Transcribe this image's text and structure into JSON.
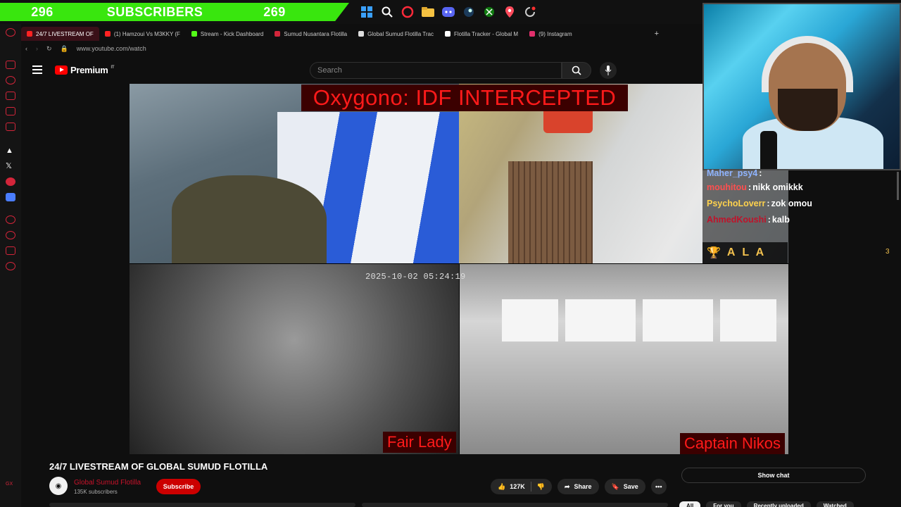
{
  "overlay": {
    "subs_left": "296",
    "subs_label": "SUBSCRIBERS",
    "subs_right": "269"
  },
  "taskbar": {
    "icons": [
      "windows-icon",
      "search-icon",
      "opera-icon",
      "folder-icon",
      "discord-icon",
      "steam-icon",
      "xbox-icon",
      "maps-icon",
      "spinner-icon"
    ]
  },
  "browser": {
    "tabs": [
      {
        "label": "24/7 LIVESTREAM OF",
        "color": "#ff2222",
        "active": true
      },
      {
        "label": "(1) Hamzoui Vs M3KKY (F",
        "color": "#ff2222",
        "active": false
      },
      {
        "label": "Stream - Kick Dashboard",
        "color": "#53fc18",
        "active": false
      },
      {
        "label": "Sumud Nusantara Flotilla",
        "color": "#d3253a",
        "active": false
      },
      {
        "label": "Global Sumud Flotilla Trac",
        "color": "#dddddd",
        "active": false
      },
      {
        "label": "Flotilla Tracker - Global M",
        "color": "#ffffff",
        "active": false
      },
      {
        "label": "(9) Instagram",
        "color": "#e1306c",
        "active": false
      }
    ],
    "new_tab": "+",
    "url": "www.youtube.com/watch"
  },
  "youtube": {
    "logo": "Premium",
    "region": "IT",
    "search_placeholder": "Search"
  },
  "video": {
    "banner": "Oxygono: IDF INTERCEPTED",
    "timestamp": "2025-10-02 05:24:19",
    "caption_left": "Fair Lady",
    "caption_right": "Captain Nikos"
  },
  "chat": {
    "messages": [
      {
        "user": "Maher_psy4",
        "text": "",
        "user_color": "#8fb4ff"
      },
      {
        "user": "mouhitou",
        "text": "nikk omikkk",
        "user_color": "#ff4f4f"
      },
      {
        "user": "PsychoLoverr",
        "text": "zok omou",
        "user_color": "#ffd24d"
      },
      {
        "user": "AhmedKoushi",
        "text": "kalb",
        "user_color": "#c0122a"
      }
    ],
    "top_badge": "A L A",
    "top_count": "3"
  },
  "meta": {
    "title": "24/7 LIVESTREAM OF GLOBAL SUMUD FLOTILLA",
    "channel": "Global Sumud Flotilla",
    "subs": "135K subscribers",
    "subscribe": "Subscribe",
    "likes": "127K",
    "share": "Share",
    "save": "Save",
    "more": "•••",
    "show_chat": "Show chat",
    "chips": [
      "All",
      "For you",
      "Recently uploaded",
      "Watched"
    ]
  }
}
